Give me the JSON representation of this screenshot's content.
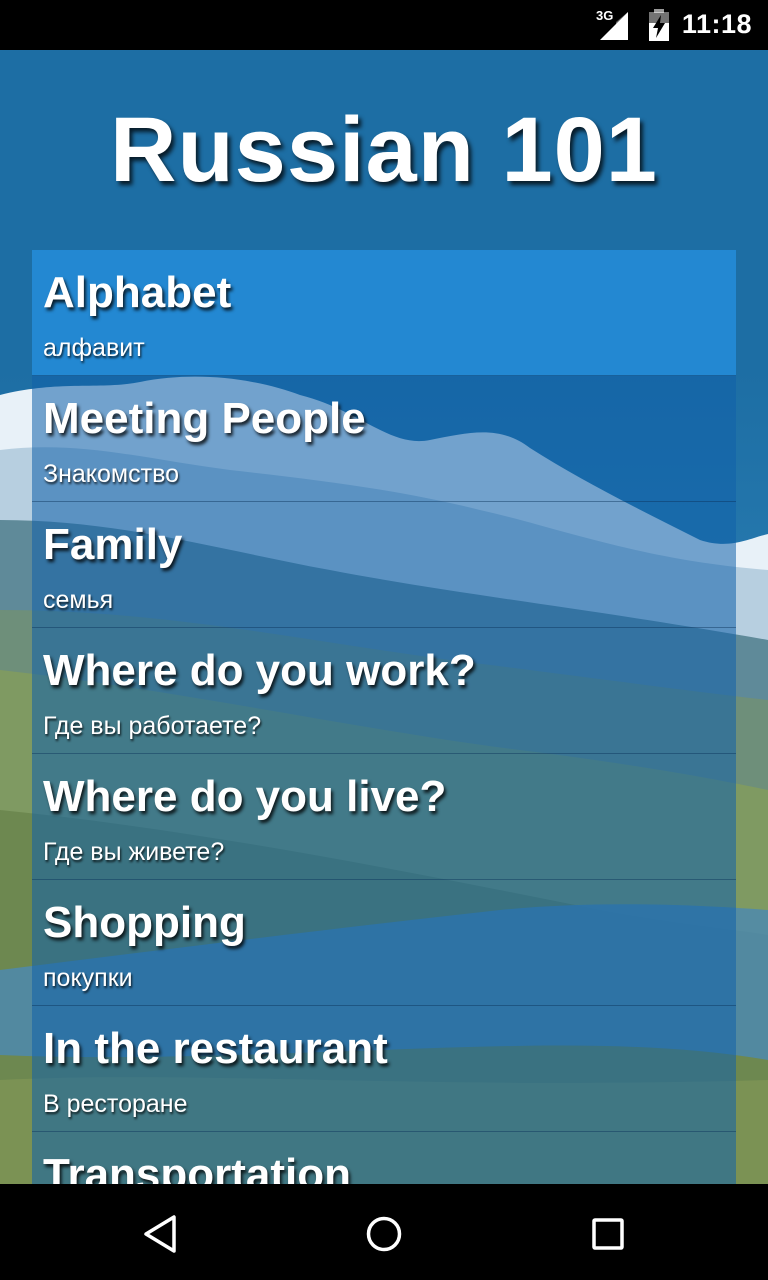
{
  "status_bar": {
    "network_label": "3G",
    "time": "11:18",
    "icons": [
      "cell-signal-icon",
      "battery-charging-icon"
    ]
  },
  "app": {
    "title": "Russian 101"
  },
  "lessons": [
    {
      "title": "Alphabet",
      "subtitle": "алфавит",
      "selected": true
    },
    {
      "title": "Meeting People",
      "subtitle": "Знакомство"
    },
    {
      "title": "Family",
      "subtitle": "семья"
    },
    {
      "title": "Where do you work?",
      "subtitle": "Где вы работаете?"
    },
    {
      "title": "Where do you live?",
      "subtitle": "Где вы живете?"
    },
    {
      "title": "Shopping",
      "subtitle": "покупки"
    },
    {
      "title": "In the restaurant",
      "subtitle": "В ресторане"
    },
    {
      "title": "Transportation",
      "subtitle": ""
    }
  ],
  "nav_bar": {
    "icons": [
      "back-icon",
      "home-icon",
      "recents-icon"
    ]
  },
  "colors": {
    "status_bar": "#000000",
    "sky": "#1d6ea4",
    "list_selected": "#2388d2",
    "text": "#ffffff"
  }
}
